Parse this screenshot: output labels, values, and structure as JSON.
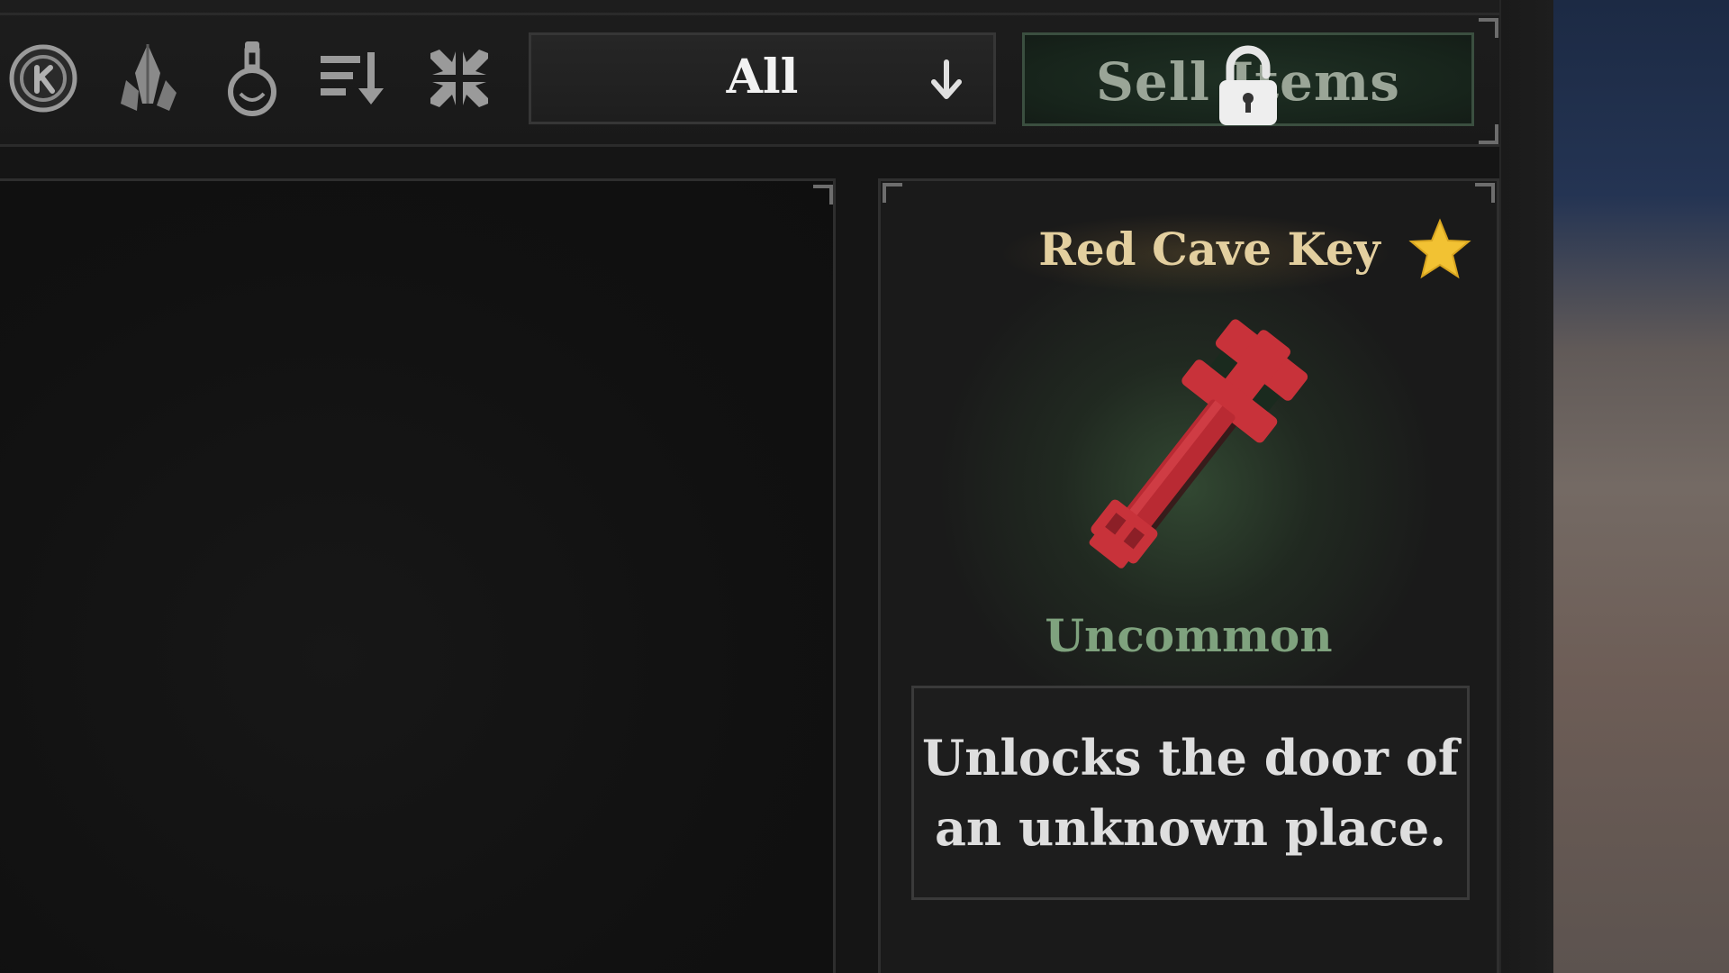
{
  "toolbar": {
    "icons": [
      {
        "name": "coin-icon"
      },
      {
        "name": "crystal-icon"
      },
      {
        "name": "potion-icon"
      },
      {
        "name": "sort-icon"
      },
      {
        "name": "collapse-icon"
      }
    ],
    "filter": {
      "selected": "All",
      "arrow_icon": "arrow-down-icon"
    },
    "sell_button": {
      "label": "Sell Items",
      "locked": true,
      "lock_icon": "lock-icon"
    }
  },
  "item_detail": {
    "name": "Red Cave Key",
    "favorite": true,
    "image_icon": "red-key-icon",
    "rarity": "Uncommon",
    "description": "Unlocks the door of an unknown place."
  },
  "colors": {
    "item_name": "#e3cf9f",
    "rarity_uncommon": "#7fa27e",
    "star": "#f2c233",
    "key": "#c8323a"
  }
}
